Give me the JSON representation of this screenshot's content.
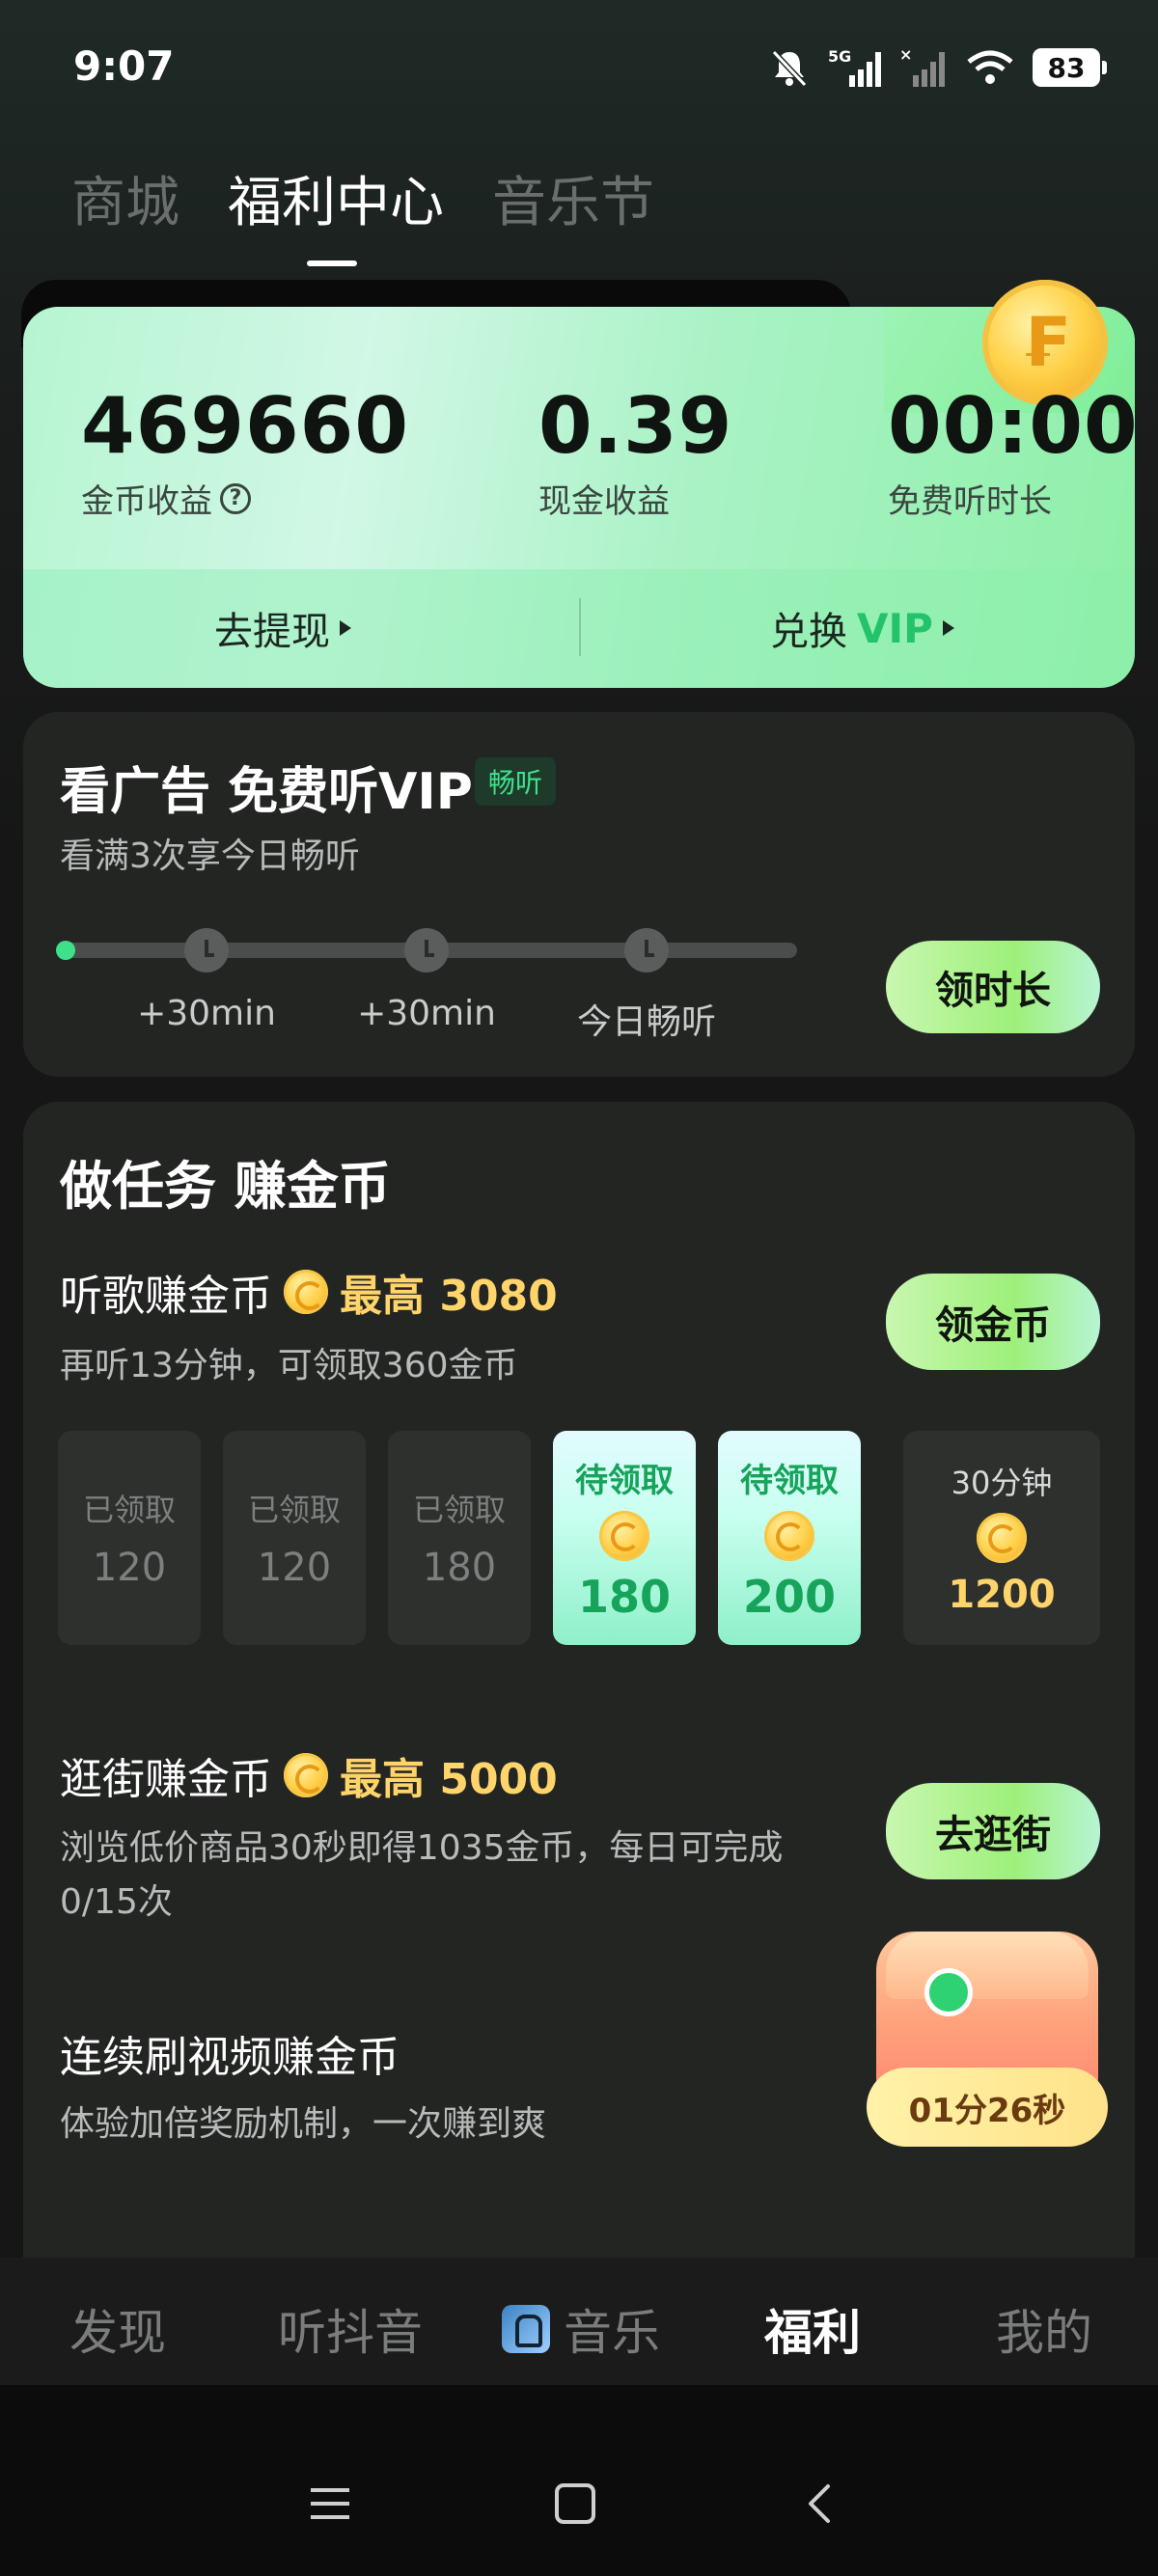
{
  "status_bar": {
    "time": "9:07",
    "battery": "83",
    "network": "5G",
    "icons": [
      "mute-icon",
      "signal-icon",
      "signal-icon",
      "wifi-icon",
      "battery-icon"
    ]
  },
  "top_tabs": [
    {
      "label": "商城",
      "active": false
    },
    {
      "label": "福利中心",
      "active": true
    },
    {
      "label": "音乐节",
      "active": false
    }
  ],
  "earnings": {
    "coin_value": "469660",
    "coin_label": "金币收益",
    "cash_value": "0.39",
    "cash_label": "现金收益",
    "listen_value": "00:00",
    "listen_label": "免费听时长",
    "withdraw_label": "去提现",
    "exchange_label": "兑换",
    "exchange_vip": "VIP",
    "help_symbol": "?"
  },
  "ad_card": {
    "title": "看广告 免费听VIP",
    "badge": "畅听",
    "subtitle": "看满3次享今日畅听",
    "steps": [
      "+30min",
      "+30min",
      "今日畅听"
    ],
    "button": "领时长"
  },
  "tasks": {
    "title": "做任务 赚金币",
    "listen": {
      "title": "听歌赚金币",
      "max_label": "最高",
      "max_value": "3080",
      "subtitle": "再听13分钟，可领取360金币",
      "button": "领金币",
      "slots": [
        {
          "status": "已领取",
          "value": "120"
        },
        {
          "status": "已领取",
          "value": "120"
        },
        {
          "status": "已领取",
          "value": "180"
        },
        {
          "status": "待领取",
          "value": "180"
        },
        {
          "status": "待领取",
          "value": "200"
        },
        {
          "status": "30分钟",
          "value": "1200"
        }
      ]
    },
    "shop": {
      "title": "逛街赚金币",
      "max_label": "最高",
      "max_value": "5000",
      "subtitle_line1": "浏览低价商品30秒即得1035金币，每日可完成",
      "subtitle_line2": "0/15次",
      "button": "去逛街"
    },
    "video": {
      "title": "连续刷视频赚金币",
      "subtitle": "体验加倍奖励机制，一次赚到爽"
    },
    "chest_timer": "01分26秒"
  },
  "bottom_nav": [
    {
      "label": "发现",
      "active": false
    },
    {
      "label": "听抖音",
      "active": false
    },
    {
      "label": "音乐",
      "active": false
    },
    {
      "label": "福利",
      "active": true
    },
    {
      "label": "我的",
      "active": false
    }
  ],
  "colors": {
    "accent_green": "#3fe08a",
    "coin_gold": "#ffd46a",
    "card_bg": "#232523"
  }
}
